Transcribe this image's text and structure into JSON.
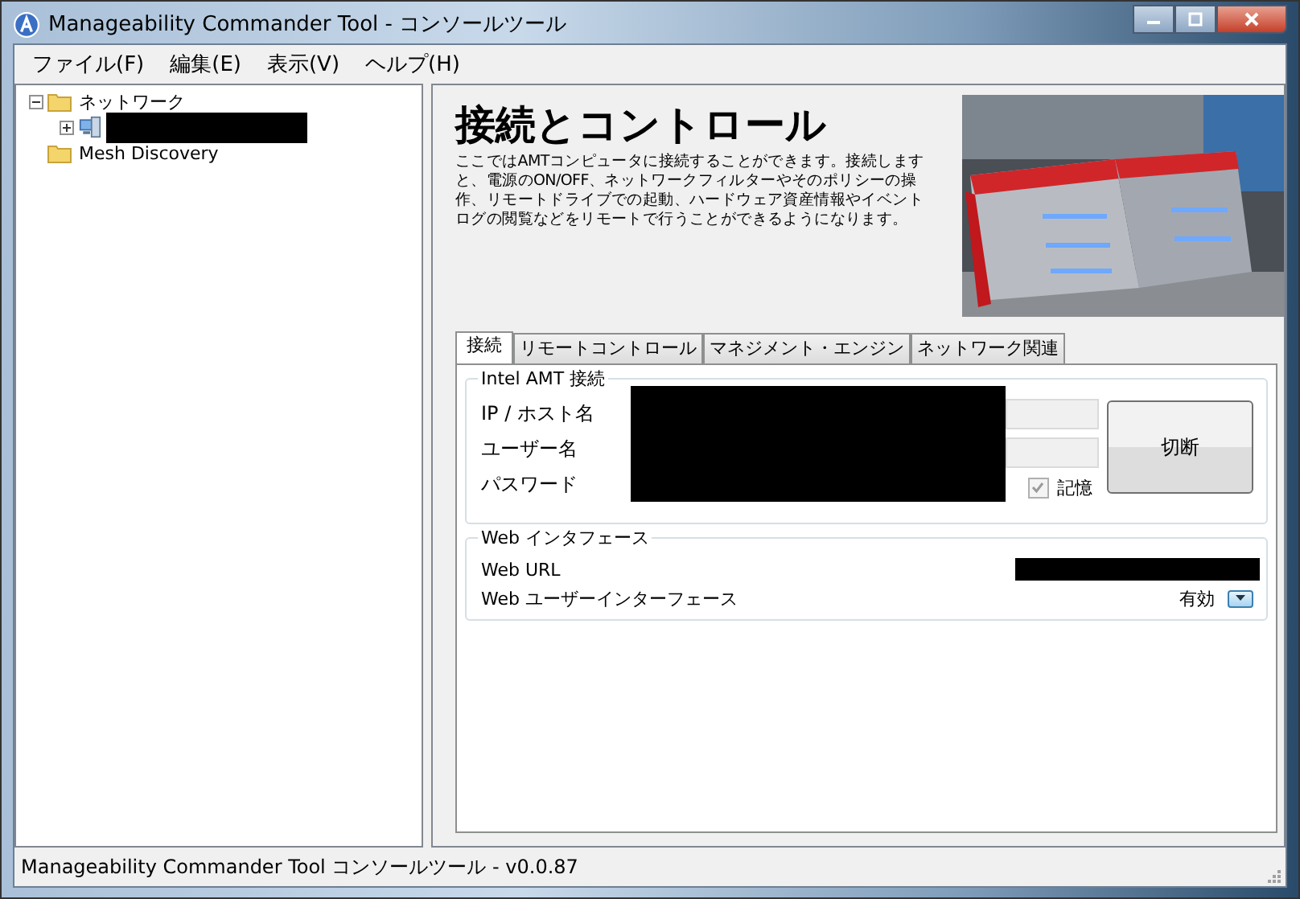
{
  "window": {
    "title": "Manageability Commander Tool - コンソールツール"
  },
  "menu": [
    {
      "label": "ファイル(F)"
    },
    {
      "label": "編集(E)"
    },
    {
      "label": "表示(V)"
    },
    {
      "label": "ヘルプ(H)"
    }
  ],
  "tree": [
    {
      "label": "ネットワーク",
      "kind": "folder",
      "expanded": true,
      "children": [
        {
          "kind": "computer",
          "expanded": false,
          "redacted": true
        }
      ]
    },
    {
      "label": "Mesh Discovery",
      "kind": "folder"
    }
  ],
  "header": {
    "title": "接続とコントロール",
    "description": "ここではAMTコンピュータに接続することができます。接続しますと、電源のON/OFF、ネットワークフィルターやそのポリシーの操作、リモートドライブでの起動、ハードウェア資産情報やイベントログの閲覧などをリモートで行うことができるようになります。"
  },
  "tabs": [
    {
      "label": "接続",
      "selected": true
    },
    {
      "label": "リモートコントロール",
      "selected": false
    },
    {
      "label": "マネジメント・エンジン",
      "selected": false
    },
    {
      "label": "ネットワーク関連",
      "selected": false
    }
  ],
  "amt_group": {
    "title": "Intel AMT 接続",
    "fields": [
      {
        "label": "IP / ホスト名"
      },
      {
        "label": "ユーザー名"
      },
      {
        "label": "パスワード"
      }
    ],
    "remember": {
      "label": "記憶",
      "checked": true,
      "disabled": true
    },
    "button": "切断"
  },
  "web_group": {
    "title": "Web インタフェース",
    "rows": [
      {
        "label": "Web URL",
        "redacted": true
      },
      {
        "label": "Web ユーザーインターフェース",
        "value": "有効"
      }
    ]
  },
  "status_bar": "Manageability Commander Tool コンソールツール - v0.0.87"
}
